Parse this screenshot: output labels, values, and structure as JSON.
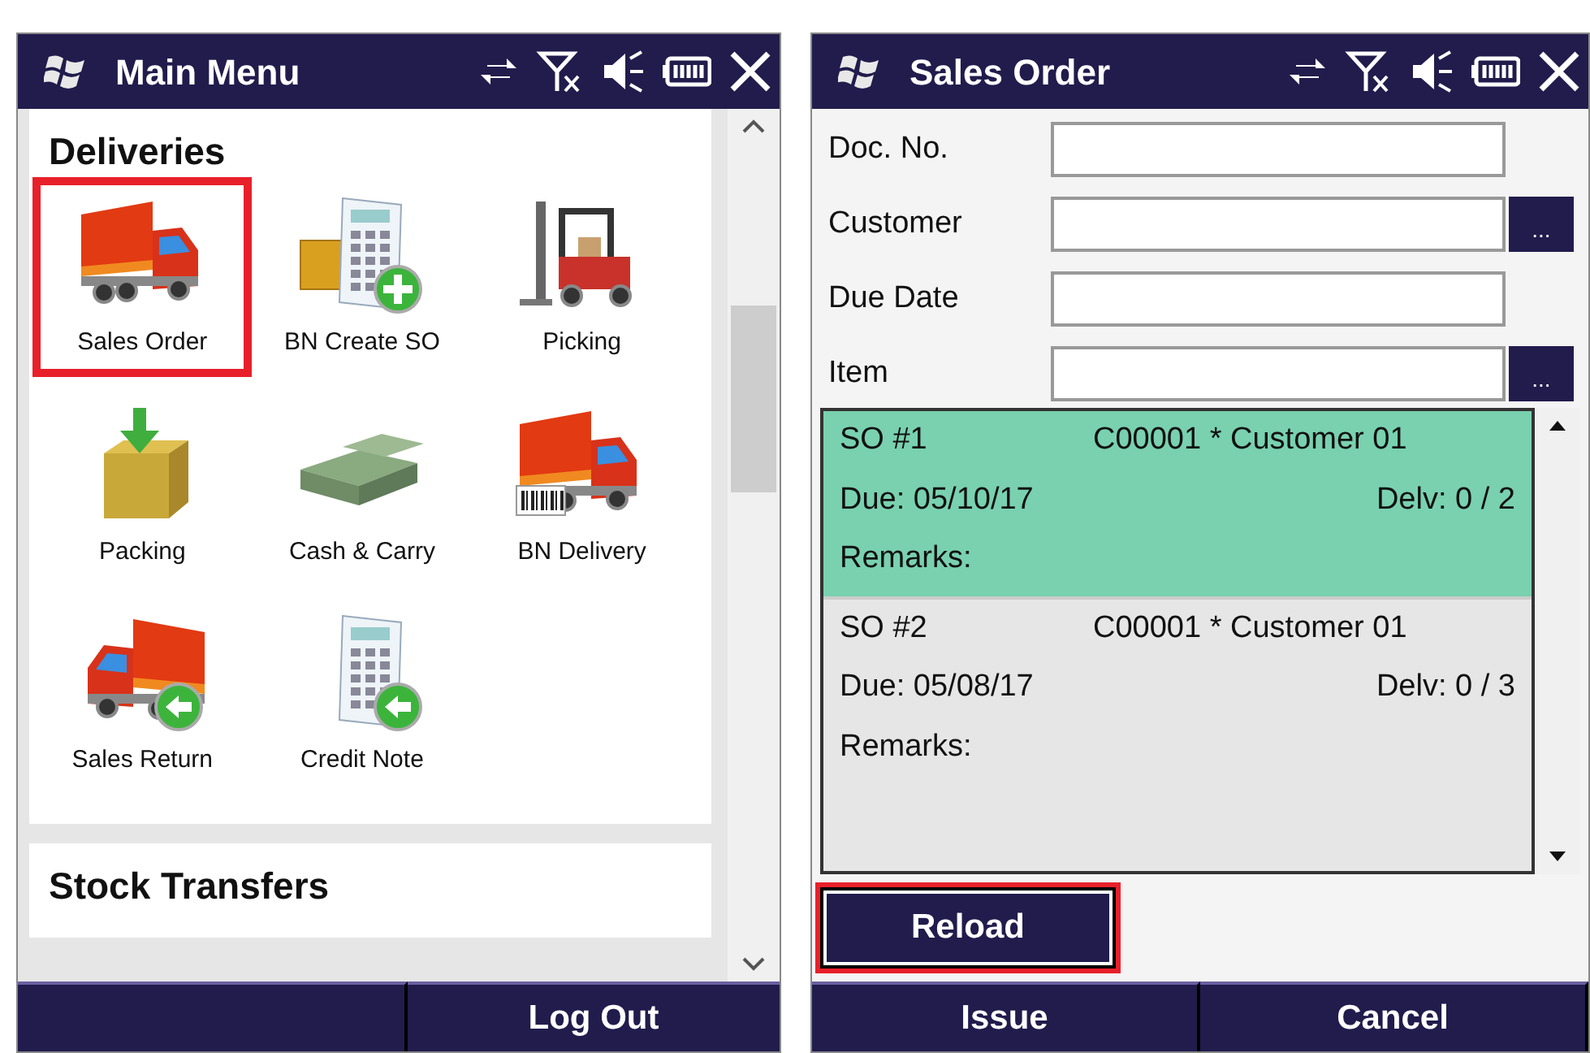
{
  "main_menu": {
    "title": "Main Menu",
    "sections": [
      {
        "title": "Deliveries",
        "items": [
          {
            "label": "Sales Order",
            "highlighted": true
          },
          {
            "label": "BN Create SO",
            "highlighted": false
          },
          {
            "label": "Picking",
            "highlighted": false
          },
          {
            "label": "Packing",
            "highlighted": false
          },
          {
            "label": "Cash & Carry",
            "highlighted": false
          },
          {
            "label": "BN Delivery",
            "highlighted": false
          },
          {
            "label": "Sales Return",
            "highlighted": false
          },
          {
            "label": "Credit Note",
            "highlighted": false
          }
        ]
      },
      {
        "title": "Stock Transfers"
      }
    ],
    "buttons": [
      "Log Out"
    ]
  },
  "sales_order": {
    "title": "Sales Order",
    "fields": [
      {
        "label": "Doc. No."
      },
      {
        "label": "Customer",
        "button": "..."
      },
      {
        "label": "Due Date"
      },
      {
        "label": "Item",
        "button": "..."
      }
    ],
    "orders": [
      {
        "number": "SO #1",
        "customer": "C00001 * Customer 01",
        "due": "Due: 05/10/17",
        "delivered": "Delv: 0 / 2",
        "remarks": "Remarks:",
        "selected": true
      },
      {
        "number": "SO #2",
        "customer": "C00001 * Customer 01",
        "due": "Due: 05/08/17",
        "delivered": "Delv: 0 / 3",
        "remarks": "Remarks:",
        "selected": false
      }
    ],
    "reload": {
      "label": "Reload",
      "highlighted": true
    },
    "buttons": [
      "Issue",
      "Cancel"
    ]
  }
}
